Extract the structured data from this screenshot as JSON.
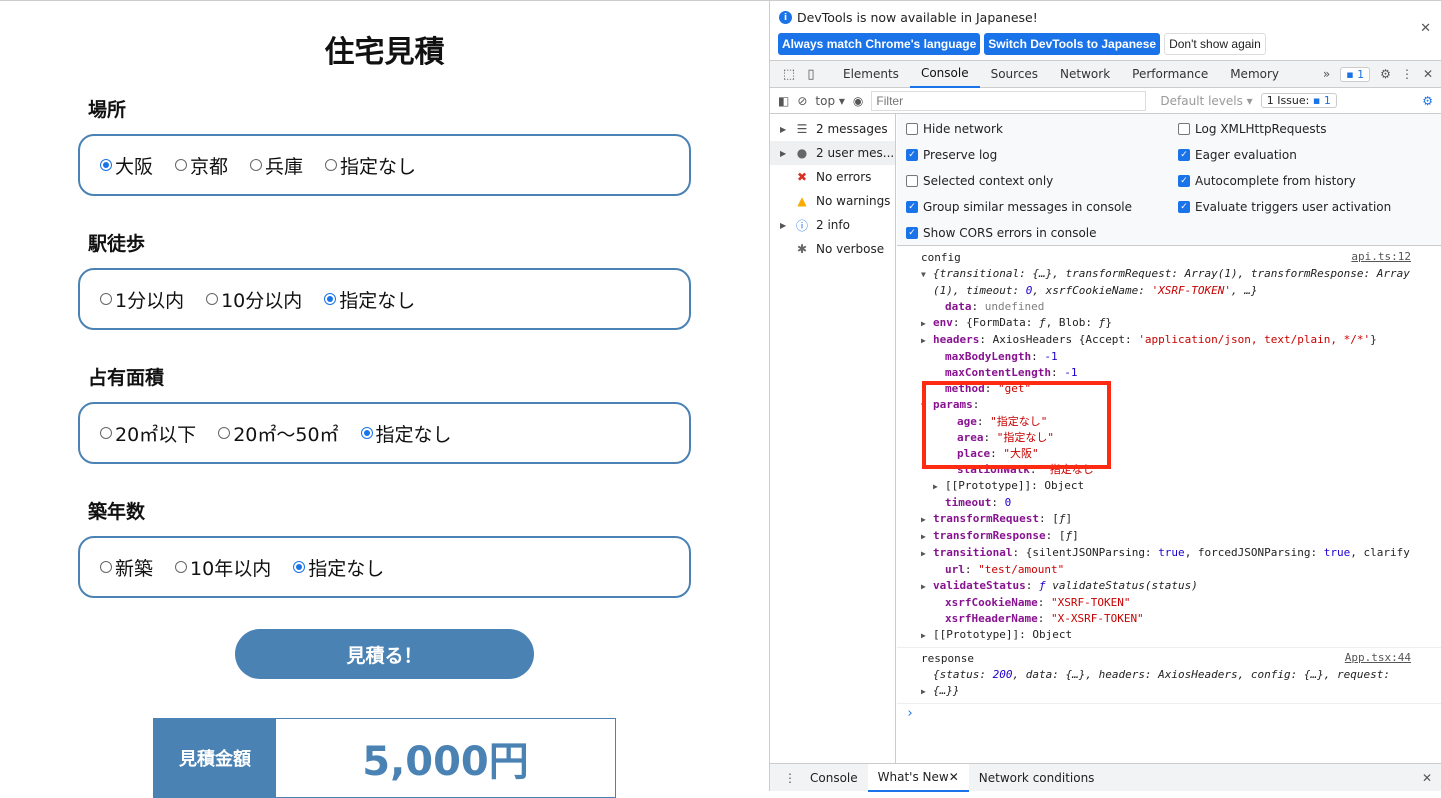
{
  "app": {
    "title": "住宅見積",
    "sections": [
      {
        "label": "場所",
        "options": [
          "大阪",
          "京都",
          "兵庫",
          "指定なし"
        ],
        "selected": 0
      },
      {
        "label": "駅徒歩",
        "options": [
          "1分以内",
          "10分以内",
          "指定なし"
        ],
        "selected": 2
      },
      {
        "label": "占有面積",
        "options": [
          "20㎡以下",
          "20㎡〜50㎡",
          "指定なし"
        ],
        "selected": 2
      },
      {
        "label": "築年数",
        "options": [
          "新築",
          "10年以内",
          "指定なし"
        ],
        "selected": 2
      }
    ],
    "button": "見積る！",
    "result_label": "見積金額",
    "result_value": "5,000円"
  },
  "devtools": {
    "info": {
      "message": "DevTools is now available in Japanese!",
      "btn_match": "Always match Chrome's language",
      "btn_switch": "Switch DevTools to Japanese",
      "btn_dont": "Don't show again"
    },
    "tabs": [
      "Elements",
      "Console",
      "Sources",
      "Network",
      "Performance",
      "Memory"
    ],
    "active_tab": "Console",
    "message_badge": "1",
    "toolbar": {
      "context": "top",
      "filter_placeholder": "Filter",
      "levels": "Default levels",
      "issues": "1 Issue:",
      "issues_count": "1"
    },
    "sidebar": [
      {
        "label": "2 messages",
        "icon": "list-icon",
        "arrow": true
      },
      {
        "label": "2 user mes...",
        "icon": "user-icon",
        "arrow": true,
        "selected": true
      },
      {
        "label": "No errors",
        "icon": "error-icon"
      },
      {
        "label": "No warnings",
        "icon": "warning-icon"
      },
      {
        "label": "2 info",
        "icon": "info-icon",
        "arrow": true
      },
      {
        "label": "No verbose",
        "icon": "bug-icon"
      }
    ],
    "settings": [
      {
        "label": "Hide network",
        "checked": false
      },
      {
        "label": "Log XMLHttpRequests",
        "checked": false
      },
      {
        "label": "Preserve log",
        "checked": true
      },
      {
        "label": "Eager evaluation",
        "checked": true
      },
      {
        "label": "Selected context only",
        "checked": false
      },
      {
        "label": "Autocomplete from history",
        "checked": true
      },
      {
        "label": "Group similar messages in console",
        "checked": true
      },
      {
        "label": "Evaluate triggers user activation",
        "checked": true
      },
      {
        "label": "Show CORS errors in console",
        "checked": true
      }
    ],
    "log": [
      {
        "title": "config",
        "source": "api.ts:12",
        "lines": [
          {
            "ind": 0,
            "tri": "down",
            "parts": [
              [
                "{transitional: {…}, transformRequest: Array(1), transformResponse: Array",
                "i p"
              ]
            ]
          },
          {
            "ind": 1,
            "parts": [
              [
                "(1), timeout: ",
                "i p"
              ],
              [
                "0",
                "i n"
              ],
              [
                ", xsrfCookieName: ",
                "i p"
              ],
              [
                "'XSRF-TOKEN'",
                "i s"
              ],
              [
                ", …}",
                "i p"
              ]
            ]
          },
          {
            "ind": 2,
            "parts": [
              [
                "data",
                "k"
              ],
              [
                ": ",
                "p"
              ],
              [
                "undefined",
                "g"
              ]
            ]
          },
          {
            "ind": 1,
            "tri": "right",
            "parts": [
              [
                "env",
                "k"
              ],
              [
                ": {FormData: ",
                "p"
              ],
              [
                "ƒ",
                "i p"
              ],
              [
                ", Blob: ",
                "p"
              ],
              [
                "ƒ",
                "i p"
              ],
              [
                "}",
                "p"
              ]
            ]
          },
          {
            "ind": 1,
            "tri": "right",
            "parts": [
              [
                "headers",
                "k"
              ],
              [
                ": AxiosHeaders {Accept: ",
                "p"
              ],
              [
                "'application/json, text/plain, */*'",
                "s"
              ],
              [
                "}",
                "p"
              ]
            ]
          },
          {
            "ind": 2,
            "parts": [
              [
                "maxBodyLength",
                "k"
              ],
              [
                ": ",
                "p"
              ],
              [
                "-1",
                "n"
              ]
            ]
          },
          {
            "ind": 2,
            "parts": [
              [
                "maxContentLength",
                "k"
              ],
              [
                ": ",
                "p"
              ],
              [
                "-1",
                "n"
              ]
            ]
          },
          {
            "ind": 2,
            "parts": [
              [
                "method",
                "k"
              ],
              [
                ": ",
                "p"
              ],
              [
                "\"get\"",
                "s"
              ]
            ]
          },
          {
            "ind": 1,
            "tri": "down",
            "parts": [
              [
                "params",
                "k"
              ],
              [
                ":",
                "p"
              ]
            ]
          },
          {
            "ind": 3,
            "parts": [
              [
                "age",
                "k"
              ],
              [
                ": ",
                "p"
              ],
              [
                "\"指定なし\"",
                "s"
              ]
            ]
          },
          {
            "ind": 3,
            "parts": [
              [
                "area",
                "k"
              ],
              [
                ": ",
                "p"
              ],
              [
                "\"指定なし\"",
                "s"
              ]
            ]
          },
          {
            "ind": 3,
            "parts": [
              [
                "place",
                "k"
              ],
              [
                ": ",
                "p"
              ],
              [
                "\"大阪\"",
                "s"
              ]
            ]
          },
          {
            "ind": 3,
            "parts": [
              [
                "stationWalk",
                "k"
              ],
              [
                ": ",
                "p"
              ],
              [
                "\"指定なし\"",
                "s"
              ]
            ]
          },
          {
            "ind": 2,
            "tri": "right",
            "parts": [
              [
                "[[Prototype]]: Object",
                "p"
              ]
            ]
          },
          {
            "ind": 2,
            "parts": [
              [
                "timeout",
                "k"
              ],
              [
                ": ",
                "p"
              ],
              [
                "0",
                "n"
              ]
            ]
          },
          {
            "ind": 1,
            "tri": "right",
            "parts": [
              [
                "transformRequest",
                "k"
              ],
              [
                ": [",
                "p"
              ],
              [
                "ƒ",
                "i p"
              ],
              [
                "]",
                "p"
              ]
            ]
          },
          {
            "ind": 1,
            "tri": "right",
            "parts": [
              [
                "transformResponse",
                "k"
              ],
              [
                ": [",
                "p"
              ],
              [
                "ƒ",
                "i p"
              ],
              [
                "]",
                "p"
              ]
            ]
          },
          {
            "ind": 1,
            "tri": "right",
            "parts": [
              [
                "transitional",
                "k"
              ],
              [
                ": {silentJSONParsing: ",
                "p"
              ],
              [
                "true",
                "n"
              ],
              [
                ", forcedJSONParsing: ",
                "p"
              ],
              [
                "true",
                "n"
              ],
              [
                ", clarify",
                "p"
              ]
            ]
          },
          {
            "ind": 2,
            "parts": [
              [
                "url",
                "k"
              ],
              [
                ": ",
                "p"
              ],
              [
                "\"test/amount\"",
                "s"
              ]
            ]
          },
          {
            "ind": 1,
            "tri": "right",
            "parts": [
              [
                "validateStatus",
                "k"
              ],
              [
                ": ",
                "p"
              ],
              [
                "ƒ",
                "i n"
              ],
              [
                " validateStatus(status)",
                "i p"
              ]
            ]
          },
          {
            "ind": 2,
            "parts": [
              [
                "xsrfCookieName",
                "k"
              ],
              [
                ": ",
                "p"
              ],
              [
                "\"XSRF-TOKEN\"",
                "s"
              ]
            ]
          },
          {
            "ind": 2,
            "parts": [
              [
                "xsrfHeaderName",
                "k"
              ],
              [
                ": ",
                "p"
              ],
              [
                "\"X-XSRF-TOKEN\"",
                "s"
              ]
            ]
          },
          {
            "ind": 1,
            "tri": "right",
            "parts": [
              [
                "[[Prototype]]: Object",
                "p"
              ]
            ]
          }
        ]
      },
      {
        "title": "response",
        "source": "App.tsx:44",
        "lines": [
          {
            "ind": 1,
            "parts": [
              [
                "{status: ",
                "i p"
              ],
              [
                "200",
                "i n"
              ],
              [
                ", data: {…}, headers: AxiosHeaders, config: {…}, request:",
                "i p"
              ]
            ]
          },
          {
            "ind": 0,
            "tri": "right",
            "parts": [
              [
                "{…}}",
                "i p"
              ]
            ]
          }
        ]
      }
    ],
    "drawer": {
      "tabs": [
        "Console",
        "What's New",
        "Network conditions"
      ],
      "active": "What's New"
    },
    "colors": {
      "accent": "#1a73e8",
      "highlight": "#ff2a12",
      "brand": "#4a82b4"
    }
  }
}
